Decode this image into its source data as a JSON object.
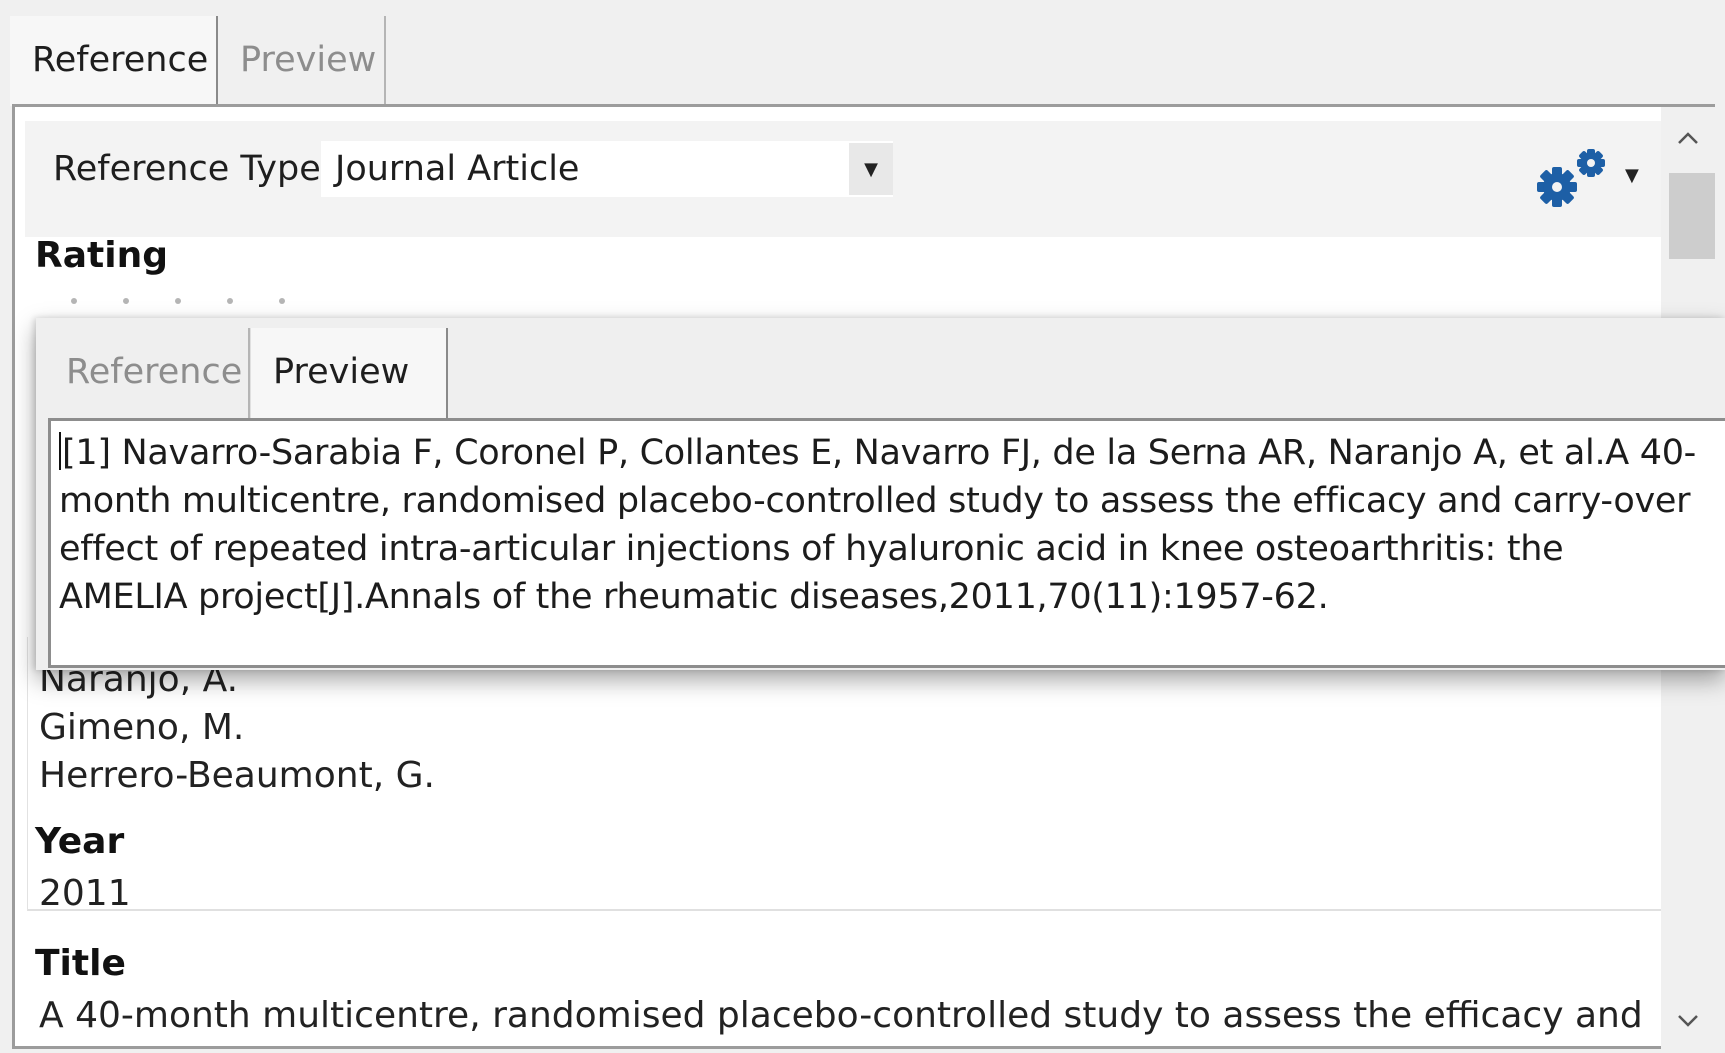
{
  "back_tabs": {
    "reference": "Reference",
    "preview": "Preview"
  },
  "reference_type": {
    "label": "Reference Type:",
    "value": "Journal Article"
  },
  "rating": {
    "label": "Rating",
    "max_stars": 5,
    "value": 0
  },
  "authors": [
    "Naranjo, A.",
    "Gimeno, M.",
    "Herrero-Beaumont, G."
  ],
  "year": {
    "label": "Year",
    "value": "2011"
  },
  "title": {
    "label": "Title",
    "value": "A 40-month multicentre, randomised placebo-controlled study to assess the efficacy and"
  },
  "overlay": {
    "tabs": {
      "reference": "Reference",
      "preview": "Preview"
    },
    "citation": "[1] Navarro-Sarabia F, Coronel P, Collantes E, Navarro FJ, de la Serna AR, Naranjo A, et al.A 40-month multicentre, randomised placebo-controlled study to assess the efficacy and carry-over effect of repeated intra-articular injections of hyaluronic acid in knee osteoarthritis: the AMELIA project[J].Annals of the rheumatic diseases,2011,70(11):1957-62."
  },
  "icons": {
    "gear": "gear-icon",
    "dropdown": "chevron-down-icon",
    "scroll_up": "chevron-up-icon",
    "scroll_down": "chevron-down-icon"
  },
  "colors": {
    "gear": "#1d5fa6"
  }
}
